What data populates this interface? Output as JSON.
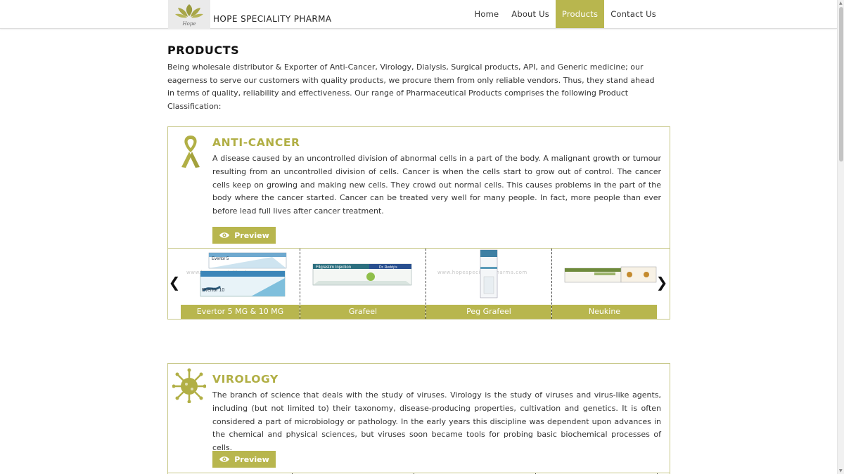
{
  "header": {
    "brand": "HOPE SPECIALITY PHARMA",
    "logo_script": "Hope",
    "nav": [
      {
        "label": "Home",
        "active": false
      },
      {
        "label": "About Us",
        "active": false
      },
      {
        "label": "Products",
        "active": true
      },
      {
        "label": "Contact Us",
        "active": false
      }
    ]
  },
  "page": {
    "title": "PRODUCTS",
    "intro": "Being wholesale distributor & Exporter of Anti-Cancer, Virology, Dialysis, Surgical products, API, and Generic medicine; our eagerness to serve our customers with quality products, we procure them from only reliable vendors. Thus, they stand ahead in terms of quality, reliability and effectiveness. Our range of Pharmaceutical Products comprises the following Product Classification:"
  },
  "categories": [
    {
      "title": "ANTI-CANCER",
      "icon": "ribbon-icon",
      "description": "A disease caused by an uncontrolled division of abnormal cells in a part of the body. A malignant growth or tumour resulting from an uncontrolled division of cells. Cancer is when the cells start to grow out of control. The cancer cells keep on growing and making new cells. They crowd out normal cells. This causes problems in the part of the body where the cancer started. Cancer can be treated very well for many people. In fact, more people than ever before lead full lives after cancer treatment.",
      "preview_label": "Preview",
      "products": [
        {
          "name": "Evertor 5 MG & 10 MG",
          "box_text_1": "Evertor 5",
          "box_text_2": "Evertor 10"
        },
        {
          "name": "Grafeel",
          "box_text_1": "Filgrastim Injection",
          "box_text_2": "Dr. Reddy's"
        },
        {
          "name": "Peg Grafeel",
          "box_text_1": "",
          "box_text_2": ""
        },
        {
          "name": "Neukine",
          "box_text_1": "",
          "box_text_2": ""
        }
      ],
      "watermark": "www.hopespecialitypharma.com",
      "prev_arrow": "❮",
      "next_arrow": "❯"
    },
    {
      "title": "VIROLOGY",
      "icon": "virus-icon",
      "description": "The branch of science that deals with the study of viruses. Virology is the study of viruses and virus-like agents, including (but not limited to) their taxonomy, disease-producing properties, cultivation and genetics. It is often considered a part of microbiology or pathology. In the early years this discipline was dependent upon advances in the chemical and physical sciences, but viruses soon became tools for probing basic biochemical processes of cells.",
      "preview_label": "Preview"
    }
  ],
  "colors": {
    "accent": "#b8b64e",
    "title": "#b1af45",
    "border": "#c6c686"
  }
}
